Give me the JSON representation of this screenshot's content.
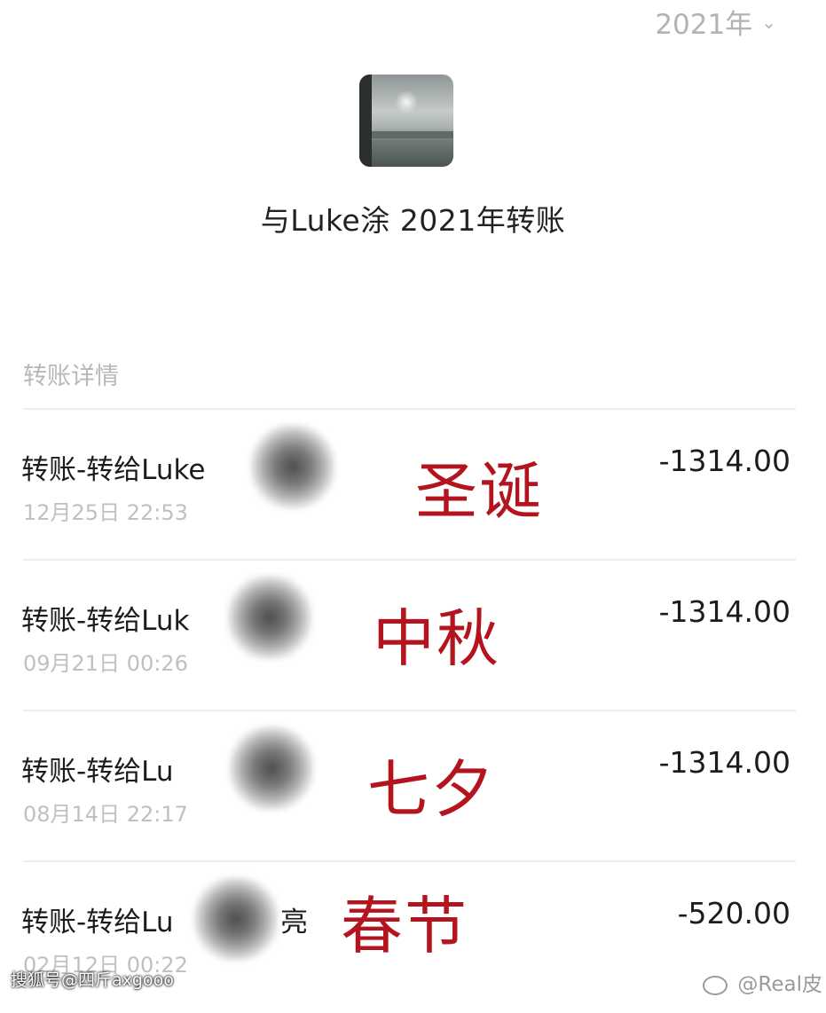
{
  "header": {
    "year": "2021年",
    "title": "与Luke涂    2021年转账"
  },
  "section_label": "转账详情",
  "transactions": [
    {
      "title": "转账-转给Luke",
      "time": "12月25日 22:53",
      "amount": "-1314.00",
      "tag": "圣诞"
    },
    {
      "title": "转账-转给Luk",
      "time": "09月21日 00:26",
      "amount": "-1314.00",
      "tag": "中秋"
    },
    {
      "title": "转账-转给Lu",
      "time": "08月14日 22:17",
      "amount": "-1314.00",
      "tag": "七夕"
    },
    {
      "title": "转账-转给Lu",
      "title_suffix": "亮",
      "time": "02月12日 00:22",
      "amount": "-520.00",
      "tag": "春节"
    }
  ],
  "watermarks": {
    "left": "搜狐号@四斤axgooo",
    "right": "@Real皮"
  },
  "colors": {
    "tag_red": "#b4141e",
    "muted_gray": "#c0c0c0"
  }
}
